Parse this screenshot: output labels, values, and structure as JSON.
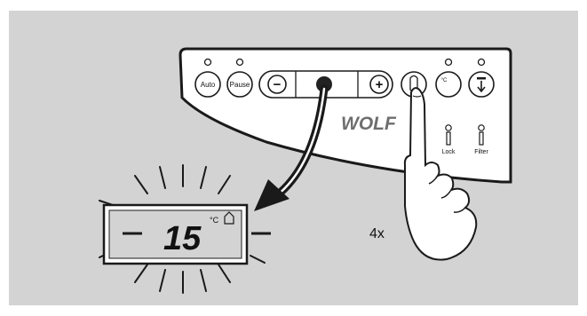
{
  "panel": {
    "buttons": {
      "auto": "Auto",
      "pause": "Pause",
      "minus": "−",
      "plus": "+"
    },
    "brand": "WOLF",
    "indicators": {
      "lock": "Lock",
      "filter": "Filter"
    },
    "temp_unit_icon": "°C"
  },
  "display": {
    "value": "15",
    "unit": "°C",
    "house_icon": "house-icon"
  },
  "instruction": {
    "press_count": "4x"
  },
  "colors": {
    "background": "#d3d3d3",
    "panel": "#ffffff",
    "stroke": "#1a1a1a"
  }
}
